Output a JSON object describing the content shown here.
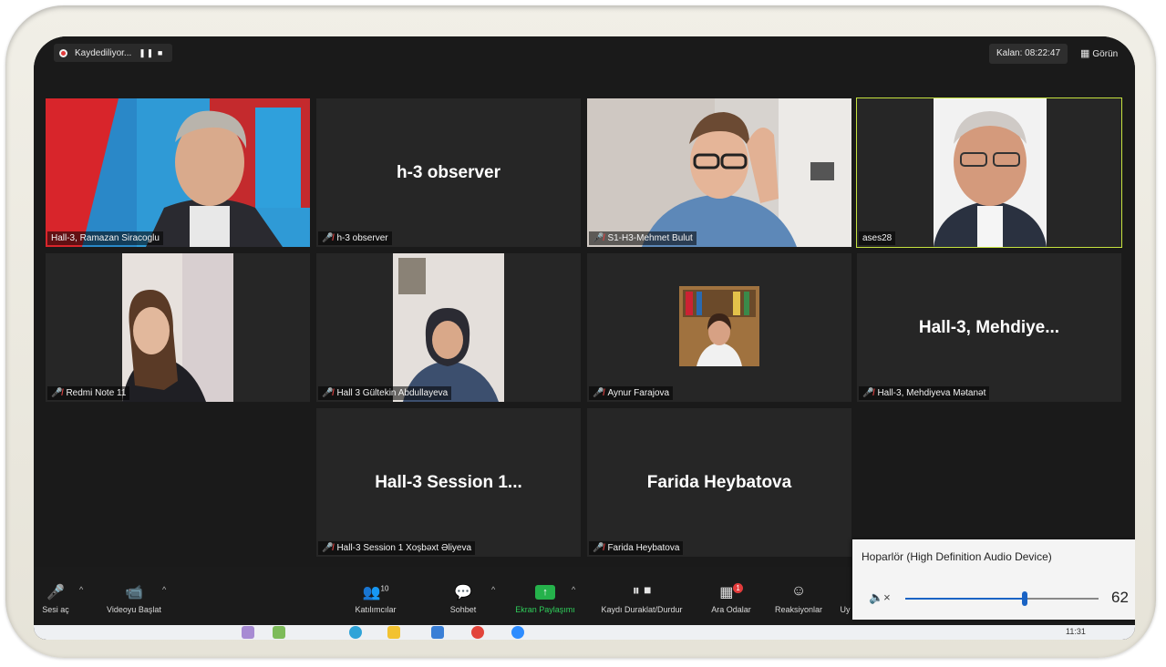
{
  "recording": {
    "label": "Kaydediliyor...",
    "controls": "❚❚ ■"
  },
  "timer": {
    "label": "Kalan: 08:22:47"
  },
  "view": {
    "label": "Görün"
  },
  "tiles": [
    {
      "name": "Hall-3, Ramazan Siracoglu",
      "big": "",
      "muted": false,
      "active": false
    },
    {
      "name": "h-3 observer",
      "big": "h-3 observer",
      "muted": true,
      "active": false
    },
    {
      "name": "S1-H3-Mehmet Bulut",
      "big": "",
      "muted": true,
      "active": false
    },
    {
      "name": "ases28",
      "big": "",
      "muted": false,
      "active": true
    },
    {
      "name": "Redmi Note 11",
      "big": "",
      "muted": true,
      "active": false
    },
    {
      "name": "Hall 3 Gültekin Abdullayeva",
      "big": "",
      "muted": true,
      "active": false
    },
    {
      "name": "Aynur Farajova",
      "big": "",
      "muted": true,
      "active": false
    },
    {
      "name": "Hall-3, Mehdiyeva Mətanət",
      "big": "Hall-3,  Mehdiye...",
      "muted": true,
      "active": false
    },
    {
      "name": "Hall-3 Session 1 Xoşbəxt Əliyeva",
      "big": "Hall-3  Session  1...",
      "muted": true,
      "active": false
    },
    {
      "name": "Farida Heybatova",
      "big": "Farida Heybatova",
      "muted": true,
      "active": false
    }
  ],
  "controls": {
    "audio": "Sesi aç",
    "video": "Videoyu Başlat",
    "participants": "Katılımcılar",
    "participants_count": "10",
    "chat": "Sohbet",
    "share": "Ekran Paylaşımı",
    "record": "Kaydı Duraklat/Durdur",
    "breakout": "Ara Odalar",
    "breakout_badge": "1",
    "reactions": "Reaksiyonlar",
    "more": "Uy"
  },
  "speaker_popup": {
    "title": "Hoparlör (High Definition Audio Device)",
    "volume": 62
  },
  "taskbar": {
    "clock": "11:31"
  },
  "colors": {
    "active_border": "#c6e23e",
    "share_green": "#25b24b",
    "mute_red": "#e04444",
    "slider_blue": "#1a63c4"
  }
}
